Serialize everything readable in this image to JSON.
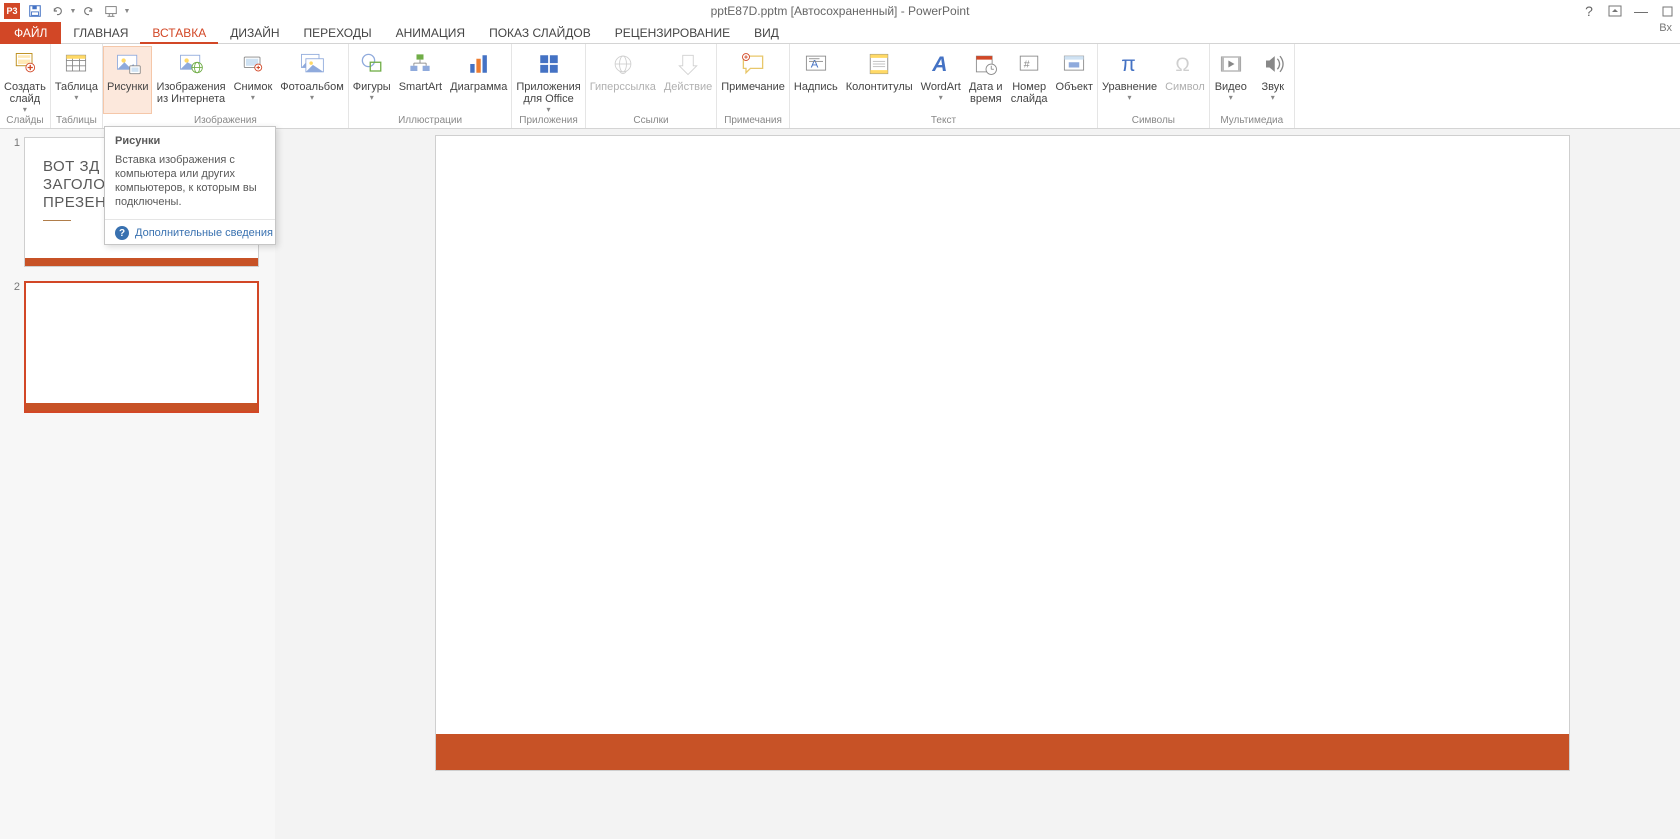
{
  "app": {
    "title": "pptE87D.pptm [Автосохраненный] - PowerPoint",
    "icon_label": "P3"
  },
  "window_controls": {
    "help": "?",
    "ribbon_display": "▣",
    "minimize": "—",
    "maximize": "☐"
  },
  "qat": {
    "save": "save",
    "undo": "undo",
    "redo": "redo",
    "start": "start-from-beginning"
  },
  "tabs": {
    "file": "ФАЙЛ",
    "home": "ГЛАВНАЯ",
    "insert": "ВСТАВКА",
    "design": "ДИЗАЙН",
    "transitions": "ПЕРЕХОДЫ",
    "animations": "АНИМАЦИЯ",
    "slideshow": "ПОКАЗ СЛАЙДОВ",
    "review": "РЕЦЕНЗИРОВАНИЕ",
    "view": "ВИД",
    "signin": "Вх"
  },
  "groups": {
    "slides": "Слайды",
    "tables": "Таблицы",
    "images": "Изображения",
    "illustrations": "Иллюстрации",
    "apps": "Приложения",
    "links": "Ссылки",
    "comments": "Примечания",
    "text": "Текст",
    "symbols": "Символы",
    "media": "Мультимедиа"
  },
  "ctrls": {
    "new_slide": "Создать\nслайд",
    "table": "Таблица",
    "pictures": "Рисунки",
    "online_pics": "Изображения\nиз Интернета",
    "screenshot": "Снимок",
    "photo_album": "Фотоальбом",
    "shapes": "Фигуры",
    "smartart": "SmartArt",
    "chart": "Диаграмма",
    "apps_office": "Приложения\nдля Office",
    "hyperlink": "Гиперссылка",
    "action": "Действие",
    "comment": "Примечание",
    "textbox": "Надпись",
    "header_footer": "Колонтитулы",
    "wordart": "WordArt",
    "date_time": "Дата и\nвремя",
    "slide_number": "Номер\nслайда",
    "object": "Объект",
    "equation": "Уравнение",
    "symbol": "Символ",
    "video": "Видео",
    "audio": "Звук"
  },
  "tooltip": {
    "title": "Рисунки",
    "body": "Вставка изображения с компьютера или других компьютеров, к которым вы подключены.",
    "more": "Дополнительные сведения"
  },
  "thumbs": {
    "s1": {
      "num": "1",
      "line1": "ВОТ ЗД",
      "line2": "ЗАГОЛО",
      "line3": "ПРЕЗЕН"
    },
    "s2": {
      "num": "2"
    }
  }
}
